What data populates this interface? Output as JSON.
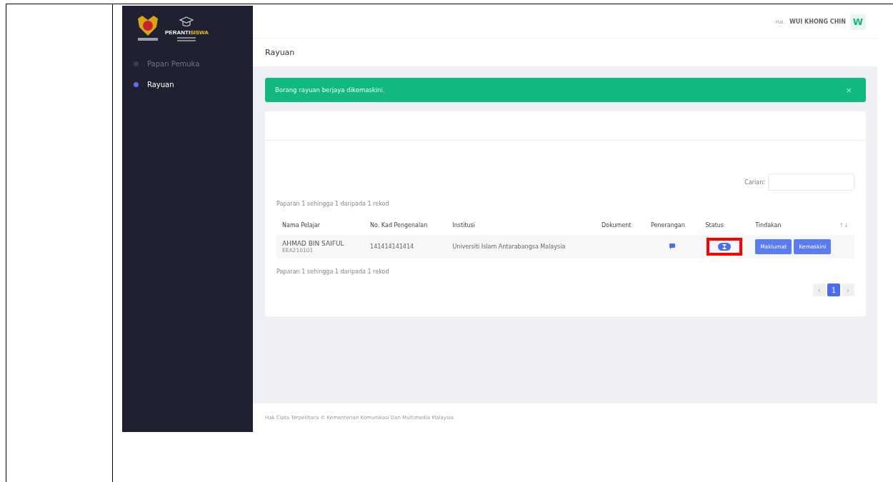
{
  "sidebar": {
    "logo_parts": [
      {
        "text": "PERANTI",
        "kind": "white"
      },
      {
        "text": "SISWA",
        "kind": "yellow"
      }
    ],
    "items": [
      {
        "label": "Papan Pemuka",
        "selected": false
      },
      {
        "label": "Rayuan",
        "selected": true
      }
    ]
  },
  "header": {
    "greeting": "Hai,",
    "user": "WUI KHONG CHIN",
    "avatar": "W"
  },
  "page_title": "Rayuan",
  "alert": {
    "message": "Borang rayuan berjaya dikemaskini.",
    "close": "×"
  },
  "search": {
    "label": "Carian:"
  },
  "summary_top": "Paparan 1 sehingga 1 daripada 1 rekod",
  "table": {
    "columns": [
      "Nama Pelajar",
      "No. Kad Pengenalan",
      "Institusi",
      "Dokument",
      "Penerangan",
      "Status",
      "Tindakan"
    ],
    "sort_icon": "↑↓",
    "rows": [
      {
        "name": "AHMAD BIN SAIFUL",
        "code": "EEA210101",
        "ic": "141414141414",
        "institution": "Universiti Islam Antarabangsa Malaysia",
        "highlighted": true,
        "actions": [
          "Maklumat",
          "Kemaskini"
        ]
      }
    ]
  },
  "summary_bottom": "Paparan 1 sehingga 1 daripada 1 rekod",
  "pagination": {
    "prev": "‹",
    "pages": [
      {
        "label": "1",
        "selected": true
      }
    ],
    "next": "›"
  },
  "footer": "Hak Cipta Terpelihara © Kementerian Komunikasi Dan Multimedia Malaysia"
}
